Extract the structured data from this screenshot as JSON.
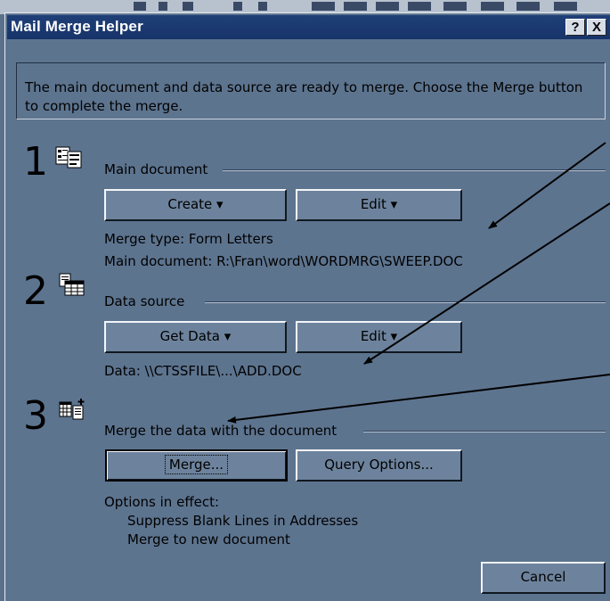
{
  "window": {
    "title": "Mail Merge Helper",
    "help_label": "?",
    "close_label": "X"
  },
  "info_text": "The main document and data source are ready to merge. Choose the Merge button to complete the merge.",
  "steps": [
    {
      "number": "1",
      "label": "Main document",
      "icon": "document-list-icon",
      "buttons": [
        "Create",
        "Edit"
      ],
      "details": [
        "Merge type: Form Letters",
        "Main document: R:\\Fran\\word\\WORDMRG\\SWEEP.DOC"
      ]
    },
    {
      "number": "2",
      "label": "Data source",
      "icon": "table-icon",
      "buttons": [
        "Get Data",
        "Edit"
      ],
      "details": [
        "Data: \\\\CTSSFILE\\...\\ADD.DOC"
      ]
    },
    {
      "number": "3",
      "label": "Merge the data with the document",
      "icon": "merge-icon",
      "buttons": [
        "Merge...",
        "Query Options..."
      ],
      "details": [
        "Options in effect:",
        "Suppress Blank Lines in Addresses",
        "Merge to new document"
      ]
    }
  ],
  "cancel_label": "Cancel",
  "colors": {
    "dialog_bg": "#5d748f",
    "title_bar": "#1f3f78",
    "arrow": "#000000"
  }
}
